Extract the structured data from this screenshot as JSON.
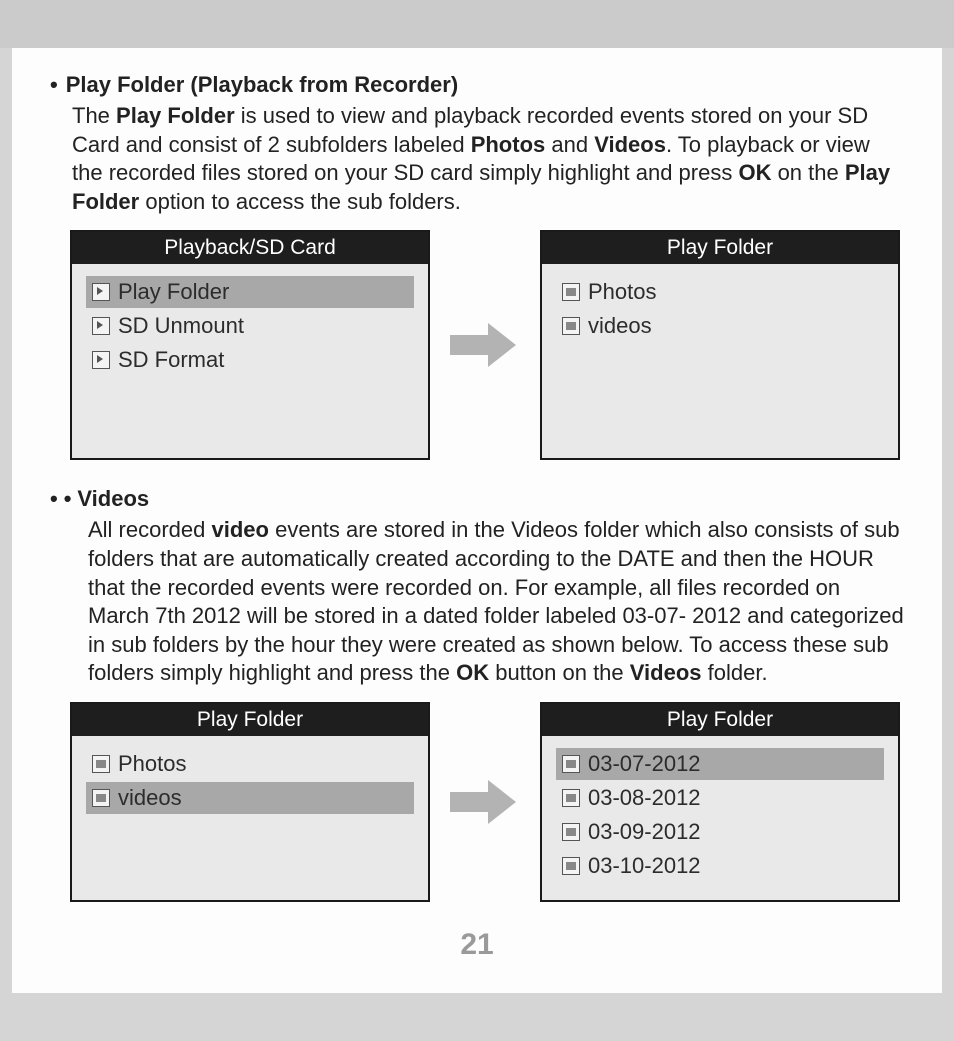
{
  "page_number": "21",
  "section1": {
    "title": "Play Folder (Playback from Recorder)",
    "p_pre": "The ",
    "p_b1": "Play Folder",
    "p_mid1": " is used to view and playback recorded events stored on your SD Card and consist of 2 subfolders labeled ",
    "p_b2": "Photos",
    "p_mid2": " and ",
    "p_b3": "Videos",
    "p_mid3": ". To playback or view the recorded files stored on your SD card simply highlight and press ",
    "p_b4": "OK",
    "p_mid4": " on the ",
    "p_b5": "Play Folder",
    "p_tail": " option to access the sub folders."
  },
  "menu1_left": {
    "title": "Playback/SD Card",
    "items": [
      {
        "label": "Play Folder",
        "selected": true,
        "icon": "play"
      },
      {
        "label": "SD Unmount",
        "selected": false,
        "icon": "play"
      },
      {
        "label": "SD Format",
        "selected": false,
        "icon": "play"
      }
    ]
  },
  "menu1_right": {
    "title": "Play Folder",
    "items": [
      {
        "label": "Photos",
        "selected": false,
        "icon": "photo"
      },
      {
        "label": "videos",
        "selected": false,
        "icon": "photo"
      }
    ]
  },
  "section2": {
    "title": "Videos",
    "p_pre": "All recorded ",
    "p_b1": "video",
    "p_mid1": " events are stored in the Videos folder which also consists of sub folders that are automatically created according to the DATE and then the HOUR that the recorded events were recorded on. For example, all files recorded on March 7th 2012 will be stored in a dated folder labeled 03-07- 2012 and categorized in sub folders by the hour they were created as shown below. To access these sub folders simply highlight and press the ",
    "p_b2": "OK",
    "p_mid2": " button on the ",
    "p_b3": "Videos",
    "p_tail": " folder."
  },
  "menu2_left": {
    "title": "Play Folder",
    "items": [
      {
        "label": "Photos",
        "selected": false,
        "icon": "photo"
      },
      {
        "label": "videos",
        "selected": true,
        "icon": "photo"
      }
    ]
  },
  "menu2_right": {
    "title": "Play Folder",
    "items": [
      {
        "label": "03-07-2012",
        "selected": true,
        "icon": "photo"
      },
      {
        "label": "03-08-2012",
        "selected": false,
        "icon": "photo"
      },
      {
        "label": "03-09-2012",
        "selected": false,
        "icon": "photo"
      },
      {
        "label": "03-10-2012",
        "selected": false,
        "icon": "photo"
      }
    ]
  }
}
